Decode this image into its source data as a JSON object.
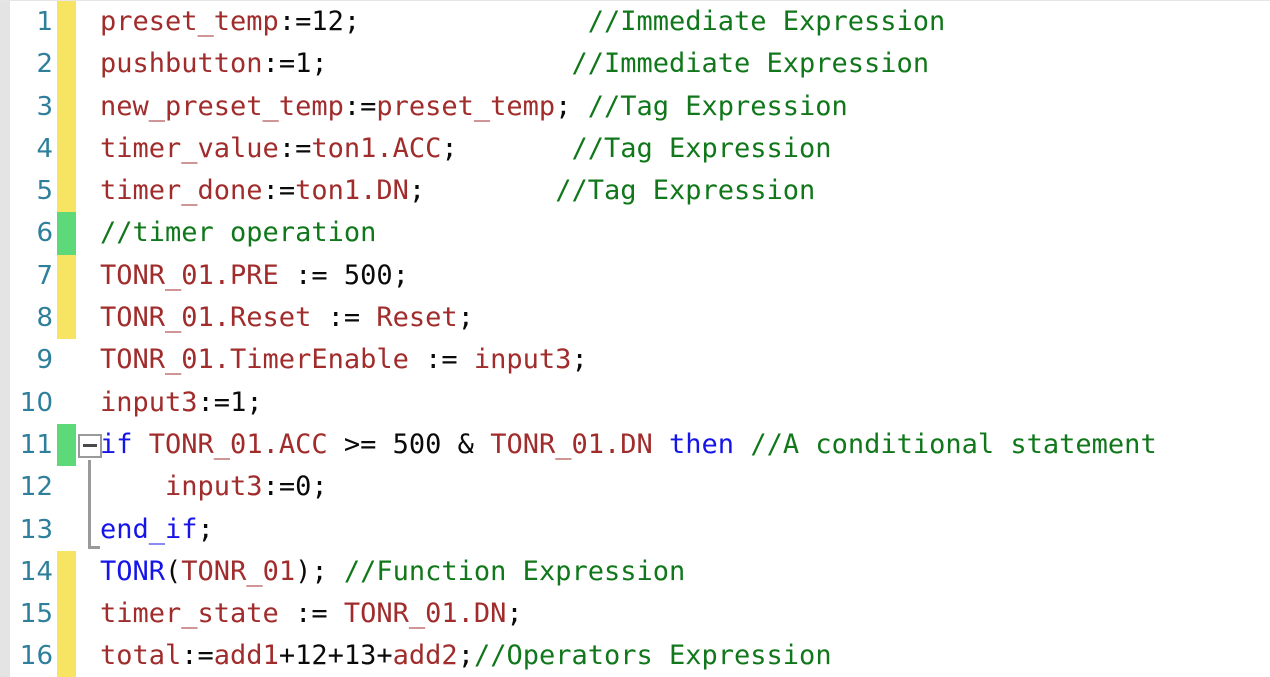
{
  "editor": {
    "language": "Structured Text",
    "colors": {
      "background": "#ffffff",
      "left_rail": "#e4e4e4",
      "line_number": "#2e7f9b",
      "gutter_modified": "#f7e463",
      "gutter_added": "#5ed97a",
      "token_tag": "#a02c2c",
      "token_keyword": "#1515e8",
      "token_comment": "#11771b",
      "token_plain": "#0a0a0a",
      "fold_widget": "#9a9a9a"
    },
    "fold_widget": {
      "state": "expanded",
      "glyph": "minus-box",
      "line": 11
    },
    "lines": [
      {
        "number": "1",
        "gutter": "modified",
        "tokens": [
          {
            "t": "preset_temp",
            "c": "tag"
          },
          {
            "t": ":=",
            "c": "plain"
          },
          {
            "t": "12",
            "c": "plain"
          },
          {
            "t": ";",
            "c": "plain"
          },
          {
            "t": "              ",
            "c": "plain"
          },
          {
            "t": "//Immediate Expression",
            "c": "comment"
          }
        ]
      },
      {
        "number": "2",
        "gutter": "modified",
        "tokens": [
          {
            "t": "pushbutton",
            "c": "tag"
          },
          {
            "t": ":=",
            "c": "plain"
          },
          {
            "t": "1",
            "c": "plain"
          },
          {
            "t": ";",
            "c": "plain"
          },
          {
            "t": "               ",
            "c": "plain"
          },
          {
            "t": "//Immediate Expression",
            "c": "comment"
          }
        ]
      },
      {
        "number": "3",
        "gutter": "modified",
        "tokens": [
          {
            "t": "new_preset_temp",
            "c": "tag"
          },
          {
            "t": ":=",
            "c": "plain"
          },
          {
            "t": "preset_temp",
            "c": "tag"
          },
          {
            "t": ";",
            "c": "plain"
          },
          {
            "t": " ",
            "c": "plain"
          },
          {
            "t": "//Tag Expression",
            "c": "comment"
          }
        ]
      },
      {
        "number": "4",
        "gutter": "modified",
        "tokens": [
          {
            "t": "timer_value",
            "c": "tag"
          },
          {
            "t": ":=",
            "c": "plain"
          },
          {
            "t": "ton1.ACC",
            "c": "tag"
          },
          {
            "t": ";",
            "c": "plain"
          },
          {
            "t": "       ",
            "c": "plain"
          },
          {
            "t": "//Tag Expression",
            "c": "comment"
          }
        ]
      },
      {
        "number": "5",
        "gutter": "modified",
        "tokens": [
          {
            "t": "timer_done",
            "c": "tag"
          },
          {
            "t": ":=",
            "c": "plain"
          },
          {
            "t": "ton1.DN",
            "c": "tag"
          },
          {
            "t": ";",
            "c": "plain"
          },
          {
            "t": "        ",
            "c": "plain"
          },
          {
            "t": "//Tag Expression",
            "c": "comment"
          }
        ]
      },
      {
        "number": "6",
        "gutter": "added",
        "tokens": [
          {
            "t": "//timer operation",
            "c": "comment"
          }
        ]
      },
      {
        "number": "7",
        "gutter": "modified",
        "tokens": [
          {
            "t": "TONR_01.PRE",
            "c": "tag"
          },
          {
            "t": " := ",
            "c": "plain"
          },
          {
            "t": "500",
            "c": "plain"
          },
          {
            "t": ";",
            "c": "plain"
          }
        ]
      },
      {
        "number": "8",
        "gutter": "modified",
        "tokens": [
          {
            "t": "TONR_01.Reset",
            "c": "tag"
          },
          {
            "t": " := ",
            "c": "plain"
          },
          {
            "t": "Reset",
            "c": "tag"
          },
          {
            "t": ";",
            "c": "plain"
          }
        ]
      },
      {
        "number": "9",
        "gutter": "none",
        "tokens": [
          {
            "t": "TONR_01.TimerEnable",
            "c": "tag"
          },
          {
            "t": " := ",
            "c": "plain"
          },
          {
            "t": "input3",
            "c": "tag"
          },
          {
            "t": ";",
            "c": "plain"
          }
        ]
      },
      {
        "number": "10",
        "gutter": "none",
        "tokens": [
          {
            "t": "input3",
            "c": "tag"
          },
          {
            "t": ":=",
            "c": "plain"
          },
          {
            "t": "1",
            "c": "plain"
          },
          {
            "t": ";",
            "c": "plain"
          }
        ]
      },
      {
        "number": "11",
        "gutter": "added",
        "tokens": [
          {
            "t": "if",
            "c": "keyword"
          },
          {
            "t": " ",
            "c": "plain"
          },
          {
            "t": "TONR_01.ACC",
            "c": "tag"
          },
          {
            "t": " >= ",
            "c": "plain"
          },
          {
            "t": "500",
            "c": "plain"
          },
          {
            "t": " & ",
            "c": "plain"
          },
          {
            "t": "TONR_01.DN",
            "c": "tag"
          },
          {
            "t": " ",
            "c": "plain"
          },
          {
            "t": "then",
            "c": "keyword"
          },
          {
            "t": " ",
            "c": "plain"
          },
          {
            "t": "//A conditional statement",
            "c": "comment"
          }
        ]
      },
      {
        "number": "12",
        "gutter": "none",
        "tokens": [
          {
            "t": "    ",
            "c": "plain"
          },
          {
            "t": "input3",
            "c": "tag"
          },
          {
            "t": ":=",
            "c": "plain"
          },
          {
            "t": "0",
            "c": "plain"
          },
          {
            "t": ";",
            "c": "plain"
          }
        ]
      },
      {
        "number": "13",
        "gutter": "none",
        "tokens": [
          {
            "t": "end_if",
            "c": "keyword"
          },
          {
            "t": ";",
            "c": "plain"
          }
        ]
      },
      {
        "number": "14",
        "gutter": "modified",
        "tokens": [
          {
            "t": "TONR",
            "c": "keyword"
          },
          {
            "t": "(",
            "c": "plain"
          },
          {
            "t": "TONR_01",
            "c": "tag"
          },
          {
            "t": ")",
            "c": "plain"
          },
          {
            "t": "; ",
            "c": "plain"
          },
          {
            "t": "//Function Expression",
            "c": "comment"
          }
        ]
      },
      {
        "number": "15",
        "gutter": "modified",
        "tokens": [
          {
            "t": "timer_state",
            "c": "tag"
          },
          {
            "t": " := ",
            "c": "plain"
          },
          {
            "t": "TONR_01.DN",
            "c": "tag"
          },
          {
            "t": ";",
            "c": "plain"
          }
        ]
      },
      {
        "number": "16",
        "gutter": "modified",
        "tokens": [
          {
            "t": "total",
            "c": "tag"
          },
          {
            "t": ":=",
            "c": "plain"
          },
          {
            "t": "add1",
            "c": "tag"
          },
          {
            "t": "+",
            "c": "plain"
          },
          {
            "t": "12",
            "c": "plain"
          },
          {
            "t": "+",
            "c": "plain"
          },
          {
            "t": "13",
            "c": "plain"
          },
          {
            "t": "+",
            "c": "plain"
          },
          {
            "t": "add2",
            "c": "tag"
          },
          {
            "t": ";",
            "c": "plain"
          },
          {
            "t": "//Operators Expression",
            "c": "comment"
          }
        ]
      }
    ]
  }
}
